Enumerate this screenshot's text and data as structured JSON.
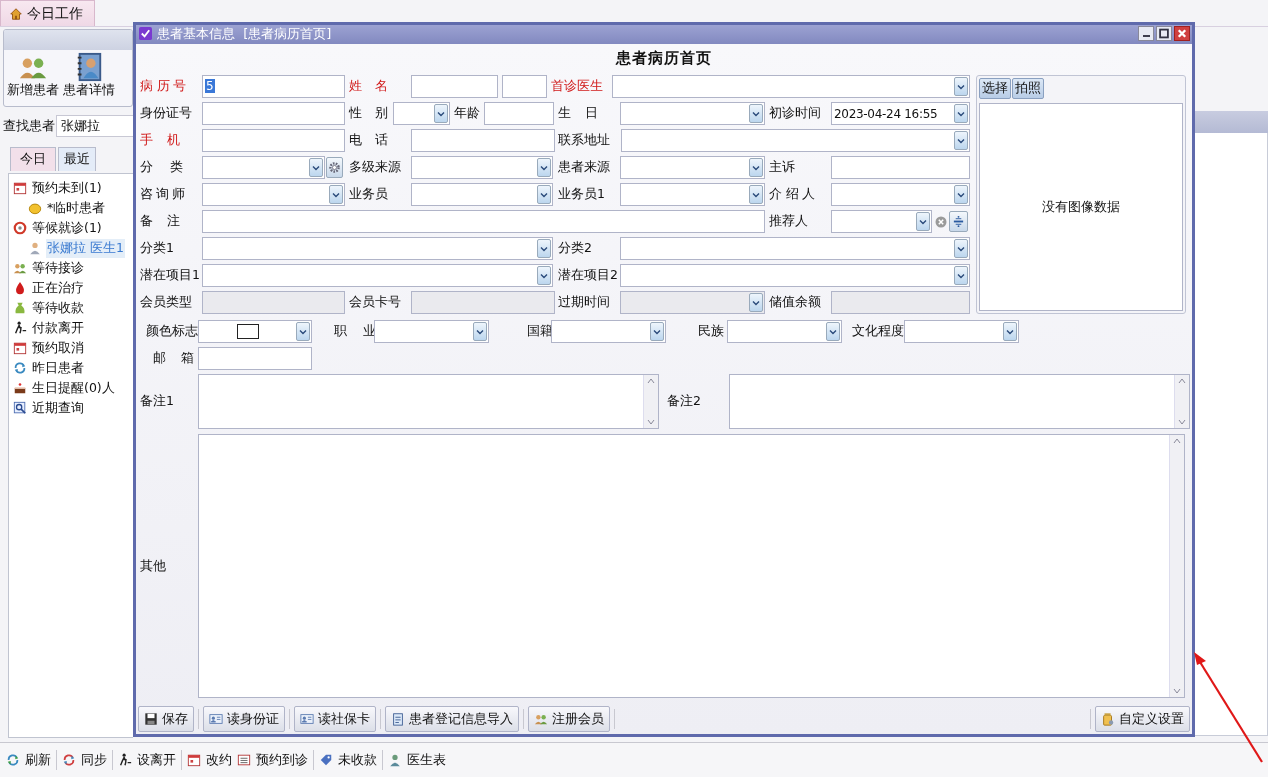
{
  "app_tab": {
    "label": "今日工作"
  },
  "toolbar": [
    {
      "label": "新增患者"
    },
    {
      "label": "患者详情"
    }
  ],
  "search": {
    "label": "查找患者",
    "value": "张娜拉"
  },
  "tabs": [
    {
      "label": "今日",
      "selected": true
    },
    {
      "label": "最近",
      "selected": false
    }
  ],
  "tree": [
    {
      "label": "预约未到(1)",
      "selected": false,
      "children": [
        {
          "label": "*临时患者",
          "selected": false
        }
      ]
    },
    {
      "label": "等候就诊(1)",
      "selected": false,
      "children": [
        {
          "label": "张娜拉 医生1",
          "selected": true
        }
      ]
    },
    {
      "label": "等待接诊",
      "selected": false
    },
    {
      "label": "正在治疗",
      "selected": false
    },
    {
      "label": "等待收款",
      "selected": false
    },
    {
      "label": "付款离开",
      "selected": false
    },
    {
      "label": "预约取消",
      "selected": false
    },
    {
      "label": "昨日患者",
      "selected": false
    },
    {
      "label": "生日提醒(0)人",
      "selected": false
    },
    {
      "label": "近期查询",
      "selected": false
    }
  ],
  "bottom_toolbar": [
    {
      "label": "刷新"
    },
    {
      "label": "同步"
    },
    {
      "label": "设离开"
    },
    {
      "label": "改约"
    },
    {
      "label": "预约到诊"
    },
    {
      "label": "未收款"
    },
    {
      "label": "医生表"
    }
  ],
  "dialog": {
    "title": "患者基本信息  [患者病历首页]",
    "heading": "患者病历首页",
    "form_rows": [
      [
        {
          "label": "病历号",
          "required": true,
          "kind": "text",
          "disabled": false,
          "value": "5"
        },
        {
          "label": "姓名",
          "required": true,
          "kind": "text",
          "disabled": false
        },
        {
          "label": "首诊医生",
          "required": true,
          "kind": "combo",
          "disabled": false
        }
      ],
      [
        {
          "label": "身份证号",
          "required": false,
          "kind": "text",
          "disabled": false
        },
        {
          "label": "性别",
          "required": false,
          "kind": "combo",
          "disabled": false
        },
        {
          "label": "年龄",
          "required": false,
          "kind": "text",
          "disabled": false
        },
        {
          "label": "生日",
          "required": false,
          "kind": "combo",
          "disabled": false
        },
        {
          "label": "初诊时间",
          "required": false,
          "kind": "combo",
          "disabled": false,
          "value": "2023-04-24 16:55"
        }
      ],
      [
        {
          "label": "手机",
          "required": true,
          "kind": "text",
          "disabled": false
        },
        {
          "label": "电话",
          "required": false,
          "kind": "text",
          "disabled": false
        },
        {
          "label": "联系地址",
          "required": false,
          "kind": "combo",
          "disabled": false
        }
      ],
      [
        {
          "label": "分类",
          "required": false,
          "kind": "combo_settings",
          "disabled": false
        },
        {
          "label": "多级来源",
          "required": false,
          "kind": "combo",
          "disabled": false
        },
        {
          "label": "患者来源",
          "required": false,
          "kind": "combo",
          "disabled": false
        },
        {
          "label": "主诉",
          "required": false,
          "kind": "text",
          "disabled": false
        }
      ],
      [
        {
          "label": "咨询师",
          "required": false,
          "kind": "combo",
          "disabled": false
        },
        {
          "label": "业务员",
          "required": false,
          "kind": "combo",
          "disabled": false
        },
        {
          "label": "业务员1",
          "required": false,
          "kind": "combo",
          "disabled": false
        },
        {
          "label": "介绍人",
          "required": false,
          "kind": "combo",
          "disabled": false
        }
      ],
      [
        {
          "label": "备注",
          "required": false,
          "kind": "text",
          "disabled": false
        },
        {
          "label": "推荐人",
          "required": false,
          "kind": "combo_picker",
          "disabled": false
        }
      ],
      [
        {
          "label": "分类1",
          "required": false,
          "kind": "combo",
          "disabled": false
        },
        {
          "label": "分类2",
          "required": false,
          "kind": "combo",
          "disabled": false
        }
      ],
      [
        {
          "label": "潜在项目1",
          "required": false,
          "kind": "combo",
          "disabled": false
        },
        {
          "label": "潜在项目2",
          "required": false,
          "kind": "combo",
          "disabled": false
        }
      ],
      [
        {
          "label": "会员类型",
          "required": false,
          "kind": "text",
          "disabled": true
        },
        {
          "label": "会员卡号",
          "required": false,
          "kind": "text",
          "disabled": true
        },
        {
          "label": "过期时间",
          "required": false,
          "kind": "combo",
          "disabled": true
        },
        {
          "label": "储值余额",
          "required": false,
          "kind": "text",
          "disabled": true
        }
      ]
    ],
    "photo": {
      "buttons": [
        {
          "label": "选择"
        },
        {
          "label": "拍照"
        }
      ],
      "empty_text": "没有图像数据"
    },
    "extra_rows": [
      [
        {
          "label": "颜色标志",
          "required": false,
          "kind": "color_combo",
          "disabled": false,
          "color": "#ffffff"
        },
        {
          "label": "职业",
          "required": false,
          "kind": "combo",
          "disabled": false
        },
        {
          "label": "国籍",
          "required": false,
          "kind": "combo",
          "disabled": false
        },
        {
          "label": "民族",
          "required": false,
          "kind": "combo",
          "disabled": false
        },
        {
          "label": "文化程度",
          "required": false,
          "kind": "combo",
          "disabled": false
        }
      ],
      [
        {
          "label": "邮箱",
          "required": false,
          "kind": "text",
          "disabled": false
        }
      ]
    ],
    "notes": [
      {
        "label": "备注1"
      },
      {
        "label": "备注2"
      }
    ],
    "other": {
      "label": "其他"
    },
    "buttons": [
      {
        "label": "保存"
      },
      {
        "label": "读身份证"
      },
      {
        "label": "读社保卡"
      },
      {
        "label": "患者登记信息导入"
      },
      {
        "label": "注册会员"
      }
    ],
    "settings_button": {
      "label": "自定义设置"
    }
  }
}
